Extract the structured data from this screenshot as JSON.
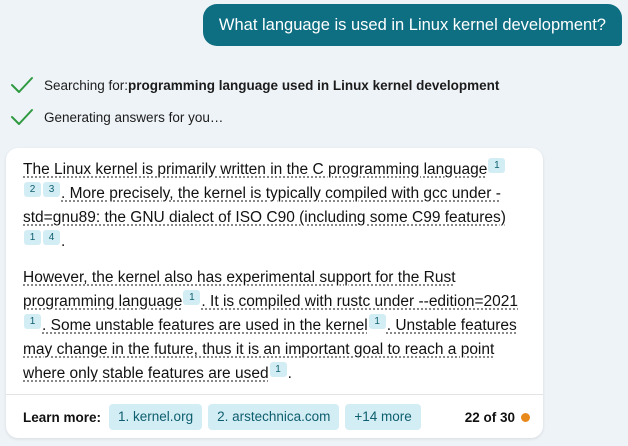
{
  "user_query": "What language is used in Linux kernel development?",
  "status": [
    {
      "label": "Searching for: ",
      "bold": "programming language used in Linux kernel development"
    },
    {
      "label": "Generating answers for you…"
    }
  ],
  "answer": {
    "p1": {
      "s1": "The Linux kernel is primarily written in the C programming language",
      "c1": [
        "1",
        "2",
        "3"
      ],
      "s2": ". More precisely, the kernel is typically compiled with gcc under -std=gnu89: the GNU dialect of ISO C90 (including some C99 features)",
      "c2": [
        "1",
        "4"
      ],
      "s3": "."
    },
    "p2": {
      "s1": "However, the kernel also has experimental support for the Rust programming language",
      "c1": "1",
      "s2": ". It is compiled with rustc under --edition=2021",
      "c2": "1",
      "s3": ". Some unstable features are used in the kernel",
      "c3": "1",
      "s4": ". Unstable features may change in the future, thus it is an important goal to reach a point where only stable features are used",
      "c4": "1",
      "s5": "."
    }
  },
  "learn_more": {
    "label": "Learn more:",
    "links": [
      "1. kernel.org",
      "2. arstechnica.com",
      "+14 more"
    ],
    "page_count": "22 of 30"
  },
  "colors": {
    "user_bubble": "#0e6e82",
    "check": "#2e9a3f",
    "chip_bg": "#d3edf4",
    "chip_text": "#0d5e6e",
    "status_dot": "#e8891c",
    "page_bg": "#eef3f8"
  },
  "icons": {
    "status_done": "checkmark-icon",
    "turn_indicator": "orange-dot-icon"
  }
}
